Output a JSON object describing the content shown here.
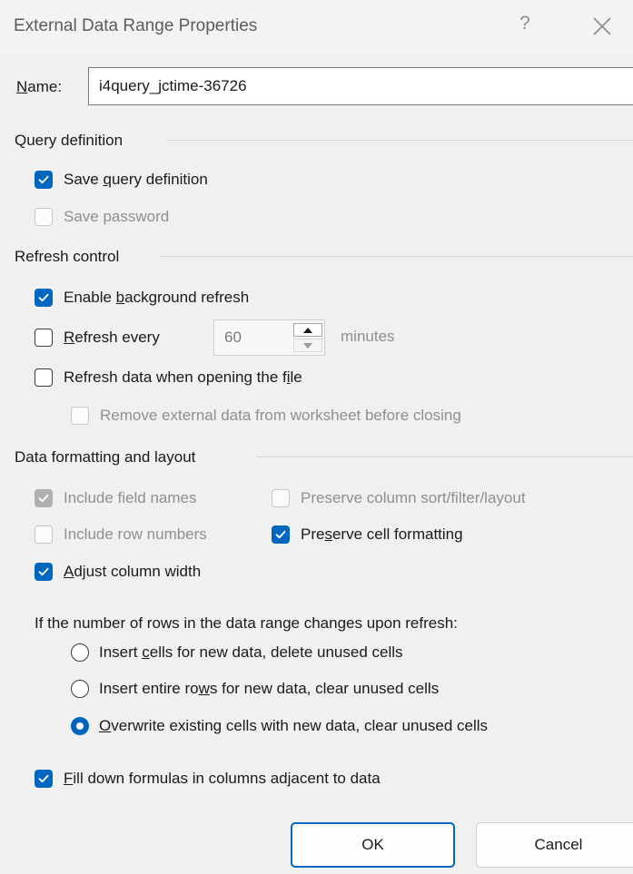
{
  "window": {
    "title": "External Data Range Properties",
    "help_label": "?"
  },
  "name": {
    "label": "Name:",
    "mnemonic": "N",
    "rest": "ame:",
    "value": "i4query_jctime-36726"
  },
  "query_definition": {
    "heading": "Query definition",
    "save_query": {
      "pre": "Save ",
      "mn": "q",
      "post": "uery definition",
      "checked": true
    },
    "save_password": {
      "label": "Save password",
      "checked": false,
      "disabled": true
    }
  },
  "refresh_control": {
    "heading": "Refresh control",
    "background": {
      "pre": "Enable ",
      "mn": "b",
      "post": "ackground refresh",
      "checked": true
    },
    "refresh_every": {
      "pre": "",
      "mn": "R",
      "post": "efresh every",
      "checked": false
    },
    "minutes_value": "60",
    "minutes_label": "minutes",
    "on_open": {
      "pre": "Refresh data when opening the f",
      "mn": "i",
      "post": "le",
      "checked": false
    },
    "remove_external": {
      "label": "Remove external data from worksheet before closing",
      "checked": false,
      "disabled": true
    }
  },
  "formatting": {
    "heading": "Data formatting and layout",
    "field_names": {
      "label": "Include field names",
      "checked": true,
      "disabled": true
    },
    "preserve_sort": {
      "label": "Preserve column sort/filter/layout",
      "checked": false,
      "disabled": true
    },
    "row_numbers": {
      "label": "Include row numbers",
      "checked": false,
      "disabled": true
    },
    "preserve_format": {
      "pre": "Pre",
      "mn": "s",
      "post": "erve cell formatting",
      "checked": true
    },
    "adjust_width": {
      "pre": "",
      "mn": "A",
      "post": "djust column width",
      "checked": true
    }
  },
  "rows_change": {
    "prompt": "If the number of rows in the data range changes upon refresh:",
    "options": [
      {
        "pre": "Insert ",
        "mn": "c",
        "post": "ells for new data, delete unused cells",
        "selected": false
      },
      {
        "pre": "Insert entire ro",
        "mn": "w",
        "post": "s for new data, clear unused cells",
        "selected": false
      },
      {
        "pre": "",
        "mn": "O",
        "post": "verwrite existing cells with new data, clear unused cells",
        "selected": true
      }
    ]
  },
  "fill_down": {
    "pre": "",
    "mn": "F",
    "post": "ill down formulas in columns adjacent to data",
    "checked": true
  },
  "buttons": {
    "ok": "OK",
    "cancel": "Cancel"
  },
  "colors": {
    "accent": "#0067c0",
    "disabled_text": "#8f8f8f",
    "background": "#f0f0f0"
  }
}
